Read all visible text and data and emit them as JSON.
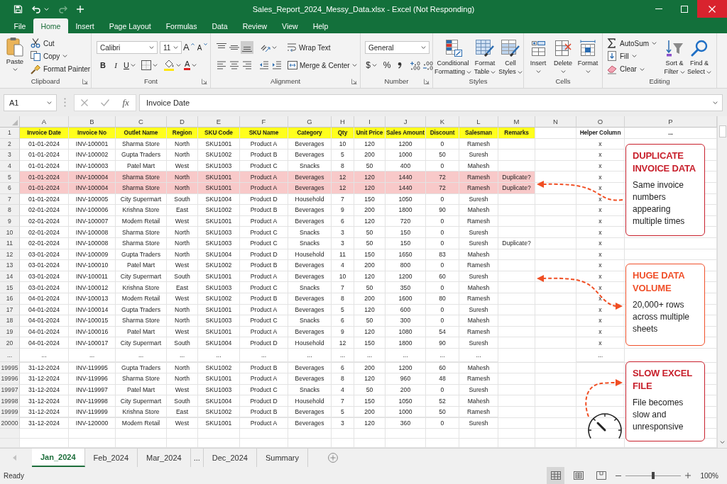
{
  "window": {
    "title": "Sales_Report_2024_Messy_Data.xlsx - Excel (Not Responding)"
  },
  "quick_access": [
    {
      "kind": "save",
      "disabled": false
    },
    {
      "kind": "undo",
      "disabled": false
    },
    {
      "kind": "redo",
      "disabled": true
    },
    {
      "kind": "customize",
      "disabled": false
    }
  ],
  "menu_tabs": [
    {
      "label": "File",
      "selected": false
    },
    {
      "label": "Home",
      "selected": true
    },
    {
      "label": "Insert",
      "selected": false
    },
    {
      "label": "Page Layout",
      "selected": false
    },
    {
      "label": "Formulas",
      "selected": false
    },
    {
      "label": "Data",
      "selected": false
    },
    {
      "label": "Review",
      "selected": false
    },
    {
      "label": "View",
      "selected": false
    },
    {
      "label": "Help",
      "selected": false
    }
  ],
  "ribbon": {
    "clipboard": {
      "label": "Clipboard",
      "paste": "Paste",
      "cut": "Cut",
      "copy": "Copy",
      "format_painter": "Format Painter"
    },
    "font": {
      "label": "Font",
      "font_name": "Calibri",
      "font_size": "11",
      "grow_font": "A",
      "shrink_font": "A",
      "bold": "B",
      "italic": "I",
      "underline": "U",
      "font_color": "A"
    },
    "alignment": {
      "label": "Alignment",
      "vertical": [
        {
          "kind": "top",
          "selected": false
        },
        {
          "kind": "middle",
          "selected": false
        },
        {
          "kind": "bottom",
          "selected": true
        }
      ],
      "horizontal": [
        {
          "kind": "left",
          "selected": false
        },
        {
          "kind": "center",
          "selected": false
        },
        {
          "kind": "right",
          "selected": false
        }
      ],
      "wrap_text": "Wrap Text",
      "merge": "Merge & Center"
    },
    "number": {
      "label": "Number",
      "format": "General",
      "currency": "$",
      "percent": "%"
    },
    "styles": {
      "label": "Styles",
      "buttons": [
        {
          "kind": "conditional-formatting",
          "label": "Conditional\nFormatting"
        },
        {
          "kind": "format-table",
          "label": "Format\nTable"
        },
        {
          "kind": "cell-styles",
          "label": "Cell\nStyles"
        }
      ]
    },
    "cells": {
      "label": "Cells",
      "buttons": [
        {
          "kind": "insert",
          "label": "Insert"
        },
        {
          "kind": "delete",
          "label": "Delete"
        },
        {
          "kind": "format",
          "label": "Format"
        }
      ]
    },
    "editing": {
      "label": "Editing",
      "small_buttons": [
        {
          "kind": "autosum",
          "label": "AutoSum"
        },
        {
          "kind": "fill",
          "label": "Fill"
        },
        {
          "kind": "clear",
          "label": "Clear"
        }
      ],
      "large_buttons": [
        {
          "kind": "sort-filter",
          "label": "Sort &\nFilter"
        },
        {
          "kind": "find-select",
          "label": "Find &\nSelect"
        }
      ]
    }
  },
  "formula_bar": {
    "name_box": "A1",
    "function_button": "fx",
    "value": "Invoice Date"
  },
  "sheet": {
    "columns": [
      "A",
      "B",
      "C",
      "D",
      "E",
      "F",
      "G",
      "H",
      "I",
      "J",
      "K",
      "L",
      "M",
      "N",
      "O",
      "P"
    ],
    "rows": [
      {
        "number": "1",
        "kind": "header",
        "cells": [
          "Invoice Date",
          "Invoice No",
          "Outlet Name",
          "Region",
          "SKU Code",
          "SKU Name",
          "Category",
          "Qty",
          "Unit Price",
          "Sales Amount",
          "Discount",
          "Salesman",
          "Remarks"
        ],
        "helper": "Helper Column",
        "more": "..."
      },
      {
        "number": "2",
        "kind": "data",
        "highlighted": false,
        "cells": [
          "01-01-2024",
          "INV-100001",
          "Sharma Store",
          "North",
          "SKU1001",
          "Product A",
          "Beverages",
          "10",
          "120",
          "1200",
          "0",
          "Ramesh"
        ],
        "helper": "x"
      },
      {
        "number": "3",
        "kind": "data",
        "highlighted": false,
        "cells": [
          "01-01-2024",
          "INV-100002",
          "Gupta Traders",
          "North",
          "SKU1002",
          "Product B",
          "Beverages",
          "5",
          "200",
          "1000",
          "50",
          "Suresh"
        ],
        "helper": "x"
      },
      {
        "number": "4",
        "kind": "data",
        "highlighted": false,
        "cells": [
          "01-01-2024",
          "INV-100003",
          "Patel Mart",
          "West",
          "SKU1003",
          "Product C",
          "Snacks",
          "8",
          "50",
          "400",
          "0",
          "Mahesh"
        ],
        "helper": "x"
      },
      {
        "number": "5",
        "kind": "data",
        "highlighted": true,
        "cells": [
          "01-01-2024",
          "INV-100004",
          "Sharma Store",
          "North",
          "SKU1001",
          "Product A",
          "Beverages",
          "12",
          "120",
          "1440",
          "72",
          "Ramesh"
        ],
        "remark": "Duplicate?",
        "helper": "x"
      },
      {
        "number": "6",
        "kind": "data",
        "highlighted": true,
        "cells": [
          "01-01-2024",
          "INV-100004",
          "Sharma Store",
          "North",
          "SKU1001",
          "Product A",
          "Beverages",
          "12",
          "120",
          "1440",
          "72",
          "Ramesh"
        ],
        "remark": "Duplicate?",
        "helper": "x"
      },
      {
        "number": "7",
        "kind": "data",
        "highlighted": false,
        "cells": [
          "01-01-2024",
          "INV-100005",
          "City Supermart",
          "South",
          "SKU1004",
          "Product D",
          "Household",
          "7",
          "150",
          "1050",
          "0",
          "Suresh"
        ],
        "helper": "x"
      },
      {
        "number": "8",
        "kind": "data",
        "highlighted": false,
        "cells": [
          "02-01-2024",
          "INV-100006",
          "Krishna Store",
          "East",
          "SKU1002",
          "Product B",
          "Beverages",
          "9",
          "200",
          "1800",
          "90",
          "Mahesh"
        ],
        "helper": "x"
      },
      {
        "number": "9",
        "kind": "data",
        "highlighted": false,
        "cells": [
          "02-01-2024",
          "INV-100007",
          "Modern Retail",
          "West",
          "SKU1001",
          "Product A",
          "Beverages",
          "6",
          "120",
          "720",
          "0",
          "Ramesh"
        ],
        "helper": "x"
      },
      {
        "number": "10",
        "kind": "data",
        "highlighted": false,
        "cells": [
          "02-01-2024",
          "INV-100008",
          "Sharma Store",
          "North",
          "SKU1003",
          "Product C",
          "Snacks",
          "3",
          "50",
          "150",
          "0",
          "Suresh"
        ],
        "helper": "x"
      },
      {
        "number": "11",
        "kind": "data",
        "highlighted": false,
        "cells": [
          "02-01-2024",
          "INV-100008",
          "Sharma Store",
          "North",
          "SKU1003",
          "Product C",
          "Snacks",
          "3",
          "50",
          "150",
          "0",
          "Suresh"
        ],
        "remark": "Duplicate?",
        "helper": "x"
      },
      {
        "number": "12",
        "kind": "data",
        "highlighted": false,
        "cells": [
          "03-01-2024",
          "INV-100009",
          "Gupta Traders",
          "North",
          "SKU1004",
          "Product D",
          "Household",
          "11",
          "150",
          "1650",
          "83",
          "Mahesh"
        ],
        "helper": "x"
      },
      {
        "number": "13",
        "kind": "data",
        "highlighted": false,
        "cells": [
          "03-01-2024",
          "INV-100010",
          "Patel Mart",
          "West",
          "SKU1002",
          "Product B",
          "Beverages",
          "4",
          "200",
          "800",
          "0",
          "Ramesh"
        ],
        "helper": "x"
      },
      {
        "number": "14",
        "kind": "data",
        "highlighted": false,
        "cells": [
          "03-01-2024",
          "INV-100011",
          "City Supermart",
          "South",
          "SKU1001",
          "Product A",
          "Beverages",
          "10",
          "120",
          "1200",
          "60",
          "Suresh"
        ],
        "helper": "x"
      },
      {
        "number": "15",
        "kind": "data",
        "highlighted": false,
        "cells": [
          "03-01-2024",
          "INV-100012",
          "Krishna Store",
          "East",
          "SKU1003",
          "Product C",
          "Snacks",
          "7",
          "50",
          "350",
          "0",
          "Mahesh"
        ],
        "helper": "x"
      },
      {
        "number": "16",
        "kind": "data",
        "highlighted": false,
        "cells": [
          "04-01-2024",
          "INV-100013",
          "Modern Retail",
          "West",
          "SKU1002",
          "Product B",
          "Beverages",
          "8",
          "200",
          "1600",
          "80",
          "Ramesh"
        ],
        "helper": "x"
      },
      {
        "number": "17",
        "kind": "data",
        "highlighted": false,
        "cells": [
          "04-01-2024",
          "INV-100014",
          "Gupta Traders",
          "North",
          "SKU1001",
          "Product A",
          "Beverages",
          "5",
          "120",
          "600",
          "0",
          "Suresh"
        ],
        "helper": "x"
      },
      {
        "number": "18",
        "kind": "data",
        "highlighted": false,
        "cells": [
          "04-01-2024",
          "INV-100015",
          "Sharma Store",
          "North",
          "SKU1003",
          "Product C",
          "Snacks",
          "6",
          "50",
          "300",
          "0",
          "Mahesh"
        ],
        "helper": "x"
      },
      {
        "number": "19",
        "kind": "data",
        "highlighted": false,
        "cells": [
          "04-01-2024",
          "INV-100016",
          "Patel Mart",
          "West",
          "SKU1001",
          "Product A",
          "Beverages",
          "9",
          "120",
          "1080",
          "54",
          "Ramesh"
        ],
        "helper": "x"
      },
      {
        "number": "20",
        "kind": "data",
        "highlighted": false,
        "cells": [
          "04-01-2024",
          "INV-100017",
          "City Supermart",
          "South",
          "SKU1004",
          "Product D",
          "Household",
          "12",
          "150",
          "1800",
          "90",
          "Suresh"
        ],
        "helper": "x"
      },
      {
        "number": "...",
        "kind": "gap",
        "highlighted": false,
        "cells": [
          "...",
          "...",
          "...",
          "...",
          "...",
          "...",
          "...",
          "...",
          "...",
          "...",
          "...",
          "..."
        ],
        "helper": "..."
      },
      {
        "number": "19995",
        "kind": "data",
        "highlighted": false,
        "cells": [
          "31-12-2024",
          "INV-119995",
          "Gupta Traders",
          "North",
          "SKU1002",
          "Product B",
          "Beverages",
          "6",
          "200",
          "1200",
          "60",
          "Mahesh"
        ]
      },
      {
        "number": "19996",
        "kind": "data",
        "highlighted": false,
        "cells": [
          "31-12-2024",
          "INV-119996",
          "Sharma Store",
          "North",
          "SKU1001",
          "Product A",
          "Beverages",
          "8",
          "120",
          "960",
          "48",
          "Ramesh"
        ]
      },
      {
        "number": "19997",
        "kind": "data",
        "highlighted": false,
        "cells": [
          "31-12-2024",
          "INV-119997",
          "Patel Mart",
          "West",
          "SKU1003",
          "Product C",
          "Snacks",
          "4",
          "50",
          "200",
          "0",
          "Suresh"
        ]
      },
      {
        "number": "19998",
        "kind": "data",
        "highlighted": false,
        "cells": [
          "31-12-2024",
          "INV-119998",
          "City Supermart",
          "South",
          "SKU1004",
          "Product D",
          "Household",
          "7",
          "150",
          "1050",
          "52",
          "Mahesh"
        ]
      },
      {
        "number": "19999",
        "kind": "data",
        "highlighted": false,
        "cells": [
          "31-12-2024",
          "INV-119999",
          "Krishna Store",
          "East",
          "SKU1002",
          "Product B",
          "Beverages",
          "5",
          "200",
          "1000",
          "50",
          "Ramesh"
        ]
      },
      {
        "number": "20000",
        "kind": "data",
        "highlighted": false,
        "cells": [
          "31-12-2024",
          "INV-120000",
          "Modern Retail",
          "West",
          "SKU1001",
          "Product A",
          "Beverages",
          "3",
          "120",
          "360",
          "0",
          "Suresh"
        ]
      }
    ]
  },
  "callouts": [
    {
      "title": "DUPLICATE INVOICE DATA",
      "body": "Same invoice numbers appearing multiple times",
      "color": "#c8202c"
    },
    {
      "title": "HUGE DATA VOLUME",
      "body": "20,000+ rows across multiple sheets",
      "color": "#f0502a"
    },
    {
      "title": "SLOW EXCEL FILE",
      "body": "File becomes slow and unresponsive",
      "color": "#c8202c"
    }
  ],
  "sheet_tabs": [
    {
      "kind": "sheet",
      "label": "Jan_2024",
      "selected": true
    },
    {
      "kind": "sheet",
      "label": "Feb_2024",
      "selected": false
    },
    {
      "kind": "sheet",
      "label": "Mar_2024",
      "selected": false
    },
    {
      "kind": "more",
      "label": "...",
      "selected": false
    },
    {
      "kind": "sheet",
      "label": "Dec_2024",
      "selected": false
    },
    {
      "kind": "sheet",
      "label": "Summary",
      "selected": false
    }
  ],
  "status_bar": {
    "status": "Ready",
    "views": [
      {
        "kind": "normal",
        "selected": true
      },
      {
        "kind": "page-layout",
        "selected": false
      },
      {
        "kind": "page-break",
        "selected": false
      }
    ],
    "zoom": {
      "level": 0.5,
      "reading": "100%"
    }
  }
}
